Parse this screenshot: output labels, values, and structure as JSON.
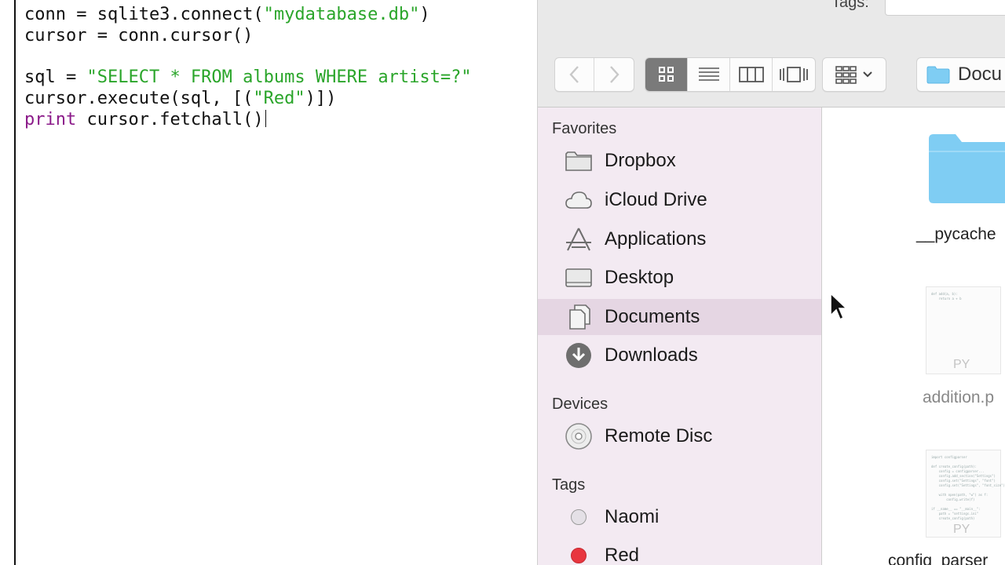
{
  "editor": {
    "code": {
      "line1": {
        "a": "conn = sqlite3.connect(",
        "s": "\"mydatabase.db\"",
        "b": ")"
      },
      "line2": "cursor = conn.cursor()",
      "line4": {
        "a": "sql = ",
        "s": "\"SELECT * FROM albums WHERE artist=?\""
      },
      "line5": {
        "a": "cursor.execute(sql, [(",
        "s": "\"Red\"",
        "b": ")])"
      },
      "line6": {
        "kw": "print",
        "b": " cursor.fetchall()"
      }
    },
    "colors": {
      "string": "#2aa52a",
      "keyword": "#8b1a89"
    }
  },
  "finder": {
    "toolbar": {
      "tags_label": "Tags:",
      "nav": [
        {
          "icon": "back-chevron-icon"
        },
        {
          "icon": "forward-chevron-icon"
        }
      ],
      "views": [
        {
          "icon": "icon-view-icon",
          "active": true
        },
        {
          "icon": "list-view-icon"
        },
        {
          "icon": "column-view-icon"
        },
        {
          "icon": "coverflow-view-icon"
        }
      ],
      "arrange": {
        "icon": "arrange-grid-icon"
      },
      "path": {
        "icon": "folder-icon",
        "label": "Docu"
      }
    },
    "sidebar": {
      "favorites_title": "Favorites",
      "favorites": [
        {
          "label": "Dropbox",
          "icon": "folder-icon"
        },
        {
          "label": "iCloud Drive",
          "icon": "cloud-icon"
        },
        {
          "label": "Applications",
          "icon": "applications-icon"
        },
        {
          "label": "Desktop",
          "icon": "desktop-icon"
        },
        {
          "label": "Documents",
          "icon": "documents-icon",
          "selected": true
        },
        {
          "label": "Downloads",
          "icon": "downloads-icon"
        }
      ],
      "devices_title": "Devices",
      "devices": [
        {
          "label": "Remote Disc",
          "icon": "disc-icon"
        }
      ],
      "tags_title": "Tags",
      "tags": [
        {
          "label": "Naomi",
          "color": "#e4e0e6"
        },
        {
          "label": "Red",
          "color": "#e8363f"
        }
      ]
    },
    "files": [
      {
        "name": "__pycache",
        "kind": "folder"
      },
      {
        "name": "addition.p",
        "kind": "py",
        "badge": "PY"
      },
      {
        "name": "config_parser",
        "kind": "py",
        "badge": "PY"
      }
    ],
    "colors": {
      "sidebar_bg": "#f3eaf2",
      "selection": "#e5d6e3",
      "folder": "#7fcdf3"
    }
  }
}
